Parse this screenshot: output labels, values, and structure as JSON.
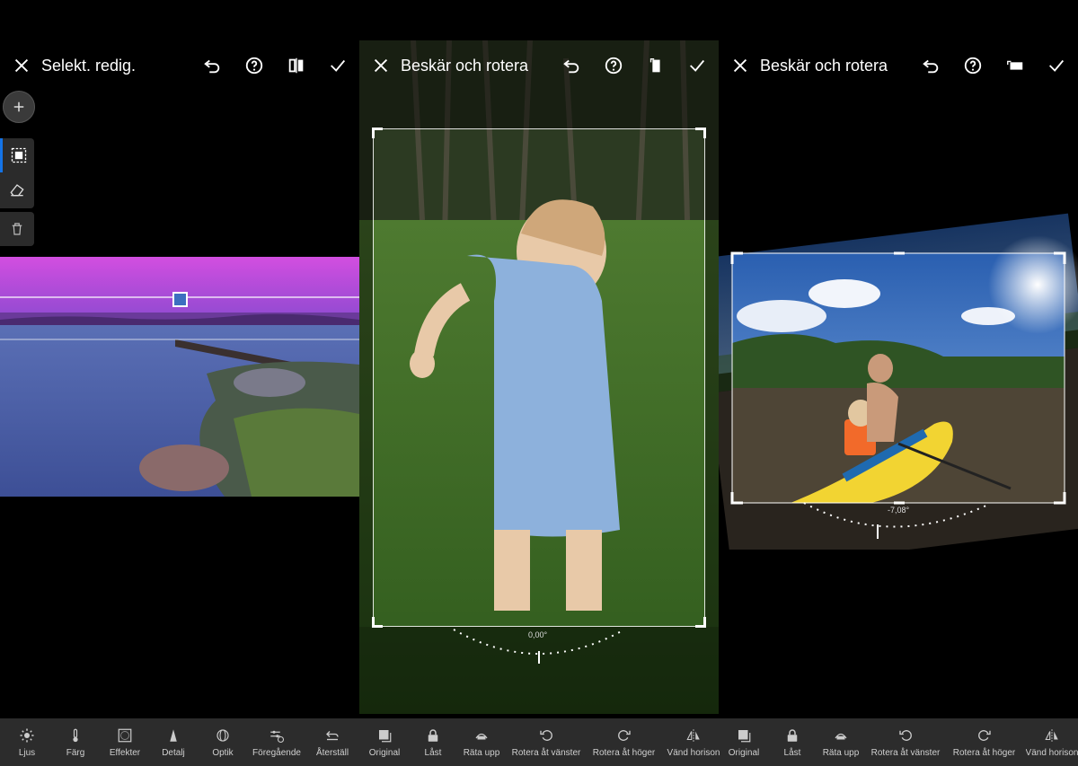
{
  "left_panel": {
    "title": "Selekt. redig."
  },
  "middle_panel": {
    "title": "Beskär och rotera",
    "angle": "0,00°"
  },
  "right_panel": {
    "title": "Beskär och rotera",
    "angle": "-7,08°"
  },
  "toolbar": {
    "items": [
      {
        "label": "Ljus",
        "icon": "sun-icon"
      },
      {
        "label": "Färg",
        "icon": "thermometer-icon"
      },
      {
        "label": "Effekter",
        "icon": "vignette-icon"
      },
      {
        "label": "Detalj",
        "icon": "triangle-icon"
      },
      {
        "label": "Optik",
        "icon": "lens-icon"
      },
      {
        "label": "Föregående",
        "icon": "sliders-icon"
      },
      {
        "label": "Återställ",
        "icon": "reset-icon"
      },
      {
        "label": "Original",
        "icon": "original-icon"
      },
      {
        "label": "Låst",
        "icon": "lock-icon"
      },
      {
        "label": "Räta upp",
        "icon": "straighten-icon"
      },
      {
        "label": "Rotera åt vänster",
        "icon": "rotate-left-icon"
      },
      {
        "label": "Rotera åt höger",
        "icon": "rotate-right-icon"
      },
      {
        "label": "Vänd horison",
        "icon": "flip-horizontal-icon"
      },
      {
        "label": "Original",
        "icon": "original-icon"
      },
      {
        "label": "Låst",
        "icon": "lock-icon"
      },
      {
        "label": "Räta upp",
        "icon": "straighten-icon"
      },
      {
        "label": "Rotera åt vänster",
        "icon": "rotate-left-icon"
      },
      {
        "label": "Rotera åt höger",
        "icon": "rotate-right-icon"
      },
      {
        "label": "Vänd horison",
        "icon": "flip-horizontal-icon"
      }
    ]
  },
  "colors": {
    "accent": "#1473e6",
    "toolbar_bg": "#2c2c2c",
    "magenta_sky": "#c34fd6"
  }
}
